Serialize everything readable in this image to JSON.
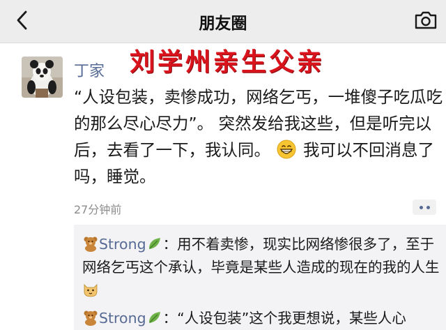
{
  "navbar": {
    "title": "朋友圈",
    "back_icon": "chevron-left-icon",
    "camera_icon": "camera-icon"
  },
  "overlay": {
    "text": "刘学州亲生父亲",
    "color": "#d9141c"
  },
  "post": {
    "author": "丁家",
    "text_part1": "“人设包装，卖惨成功，网络乞丐，一堆傻子吃瓜吃的那么尽心尽力”。 突然发给我这些，但是听完以后，去看了一下，我认同。",
    "emoji": "grinning-face-icon",
    "text_part2": "我可以不回消息了吗，睡觉。",
    "time": "27分钟前",
    "more_icon": "more-dots-icon"
  },
  "comments": [
    {
      "name": "Strong",
      "text": "：用不着卖惨，现实比网络惨很多了，至于网络乞丐这个承认，毕竟是某些人造成的现在的我的人生",
      "badge_icon": "teddy-bear-icon",
      "suffix_icon": "leaf-icon",
      "end_emoji": "cat-face-icon"
    },
    {
      "name": "Strong",
      "text": "：“人设包装”这个我更想说，某些人心",
      "badge_icon": "teddy-bear-icon",
      "suffix_icon": "leaf-icon"
    }
  ],
  "colors": {
    "link": "#576b95",
    "nav_bg": "#ededed",
    "comment_bg": "#f3f3f5"
  }
}
